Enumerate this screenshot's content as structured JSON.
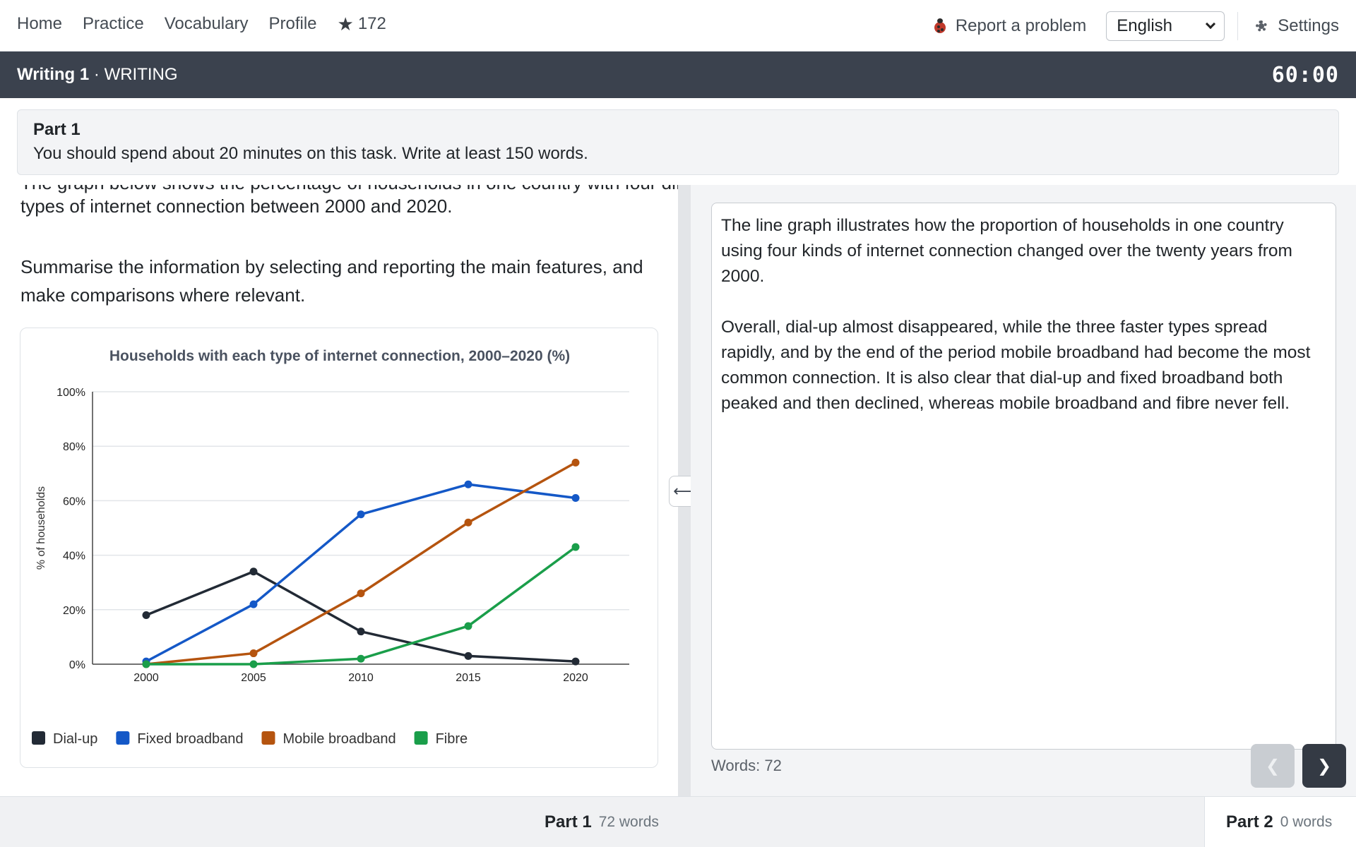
{
  "nav": {
    "home": "Home",
    "practice": "Practice",
    "vocabulary": "Vocabulary",
    "profile": "Profile",
    "stars": "172",
    "report": "Report a problem",
    "language": "English",
    "settings": "Settings"
  },
  "titlebar": {
    "test": "Writing 1",
    "section": "· WRITING",
    "timer": "60:00"
  },
  "instruction": {
    "part": "Part 1",
    "text": "You should spend about 20 minutes on this task. Write at least 150 words."
  },
  "prompt": {
    "line_cut": "The graph below shows the percentage of households in one country with four different",
    "line": "types of internet connection between 2000 and 2020.",
    "summarise": "Summarise the information by selecting and reporting the main features, and make comparisons where relevant."
  },
  "chart_data": {
    "type": "line",
    "title": "Households with each type of internet connection, 2000–2020 (%)",
    "ylabel": "% of households",
    "xlabel": "",
    "x": [
      2000,
      2005,
      2010,
      2015,
      2020
    ],
    "x_ticks": [
      "2000",
      "2005",
      "2010",
      "2015",
      "2020"
    ],
    "y_ticks": [
      "0%",
      "20%",
      "40%",
      "60%",
      "80%",
      "100%"
    ],
    "ylim": [
      0,
      100
    ],
    "grid": true,
    "legend_position": "bottom-left",
    "series": [
      {
        "name": "Dial-up",
        "color": "#222a35",
        "values": [
          18,
          34,
          12,
          3,
          1
        ]
      },
      {
        "name": "Fixed broadband",
        "color": "#1458c7",
        "values": [
          1,
          22,
          55,
          66,
          61
        ]
      },
      {
        "name": "Mobile broadband",
        "color": "#b5540f",
        "values": [
          0,
          4,
          26,
          52,
          74
        ]
      },
      {
        "name": "Fibre",
        "color": "#1a9e4a",
        "values": [
          0,
          0,
          2,
          14,
          43
        ]
      }
    ]
  },
  "essay": {
    "p1": "The line graph illustrates how the proportion of households in one country using four kinds of internet connection changed over the twenty years from 2000.",
    "p2": "Overall, dial-up almost disappeared, while the three faster types spread rapidly, and by the end of the period mobile broadband had become the most common connection. It is also clear that dial-up and fixed broadband both peaked and then declined, whereas mobile broadband and fibre never fell."
  },
  "words_label": "Words: 72",
  "buttons": {
    "prev": "❮",
    "next": "❯",
    "split": "⟷"
  },
  "footer": {
    "part1_title": "Part 1",
    "part1_words": "72 words",
    "part2_title": "Part 2",
    "part2_words": "0 words"
  }
}
